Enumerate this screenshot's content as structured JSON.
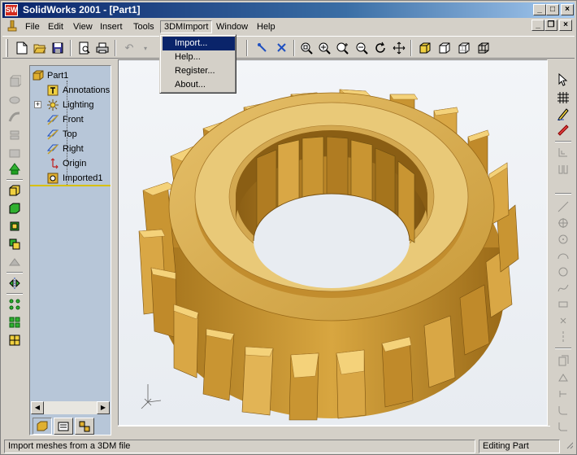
{
  "titlebar": {
    "app_icon_text": "SW",
    "title": "SolidWorks 2001 - [Part1]"
  },
  "menubar": {
    "items": [
      "File",
      "Edit",
      "View",
      "Insert",
      "Tools",
      "3DMImport",
      "Window",
      "Help"
    ]
  },
  "dropdown": {
    "items": [
      "Import...",
      "Help...",
      "Register...",
      "About..."
    ]
  },
  "feature_tree": {
    "items": [
      {
        "label": "Part1",
        "icon": "part-icon"
      },
      {
        "label": "Annotations",
        "icon": "annotations-icon"
      },
      {
        "label": "Lighting",
        "icon": "lighting-icon"
      },
      {
        "label": "Front",
        "icon": "plane-icon"
      },
      {
        "label": "Top",
        "icon": "plane-icon"
      },
      {
        "label": "Right",
        "icon": "plane-icon"
      },
      {
        "label": "Origin",
        "icon": "origin-icon"
      },
      {
        "label": "Imported1",
        "icon": "imported-feature-icon"
      }
    ]
  },
  "statusbar": {
    "message": "Import meshes from a 3DM file",
    "mode": "Editing Part"
  },
  "colors": {
    "title_active": "#0a246a",
    "tree_background": "#b7c6d8",
    "gear_body": "#c8962e",
    "gear_highlight": "#f4d27a",
    "rollback_bar": "#d8c000"
  }
}
